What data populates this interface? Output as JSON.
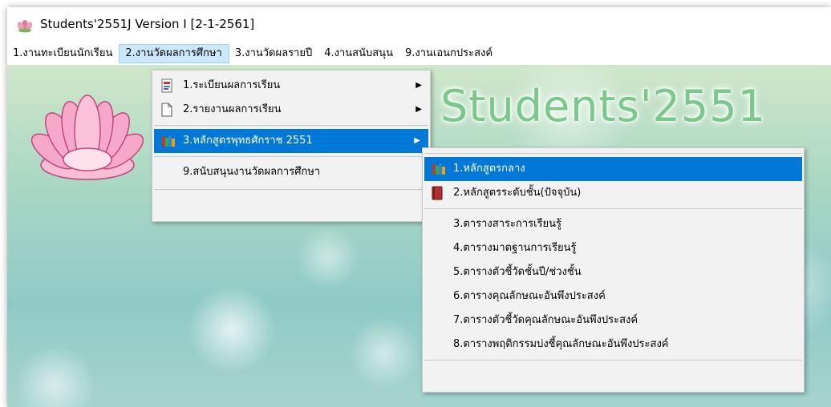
{
  "window": {
    "title": "Students'2551J Version I [2-1-2561]",
    "icon": "lotus-app-icon"
  },
  "menubar": {
    "items": [
      {
        "label": "1.งานทะเบียนนักเรียน"
      },
      {
        "label": "2.งานวัดผลการศึกษา",
        "active": true
      },
      {
        "label": "3.งานวัดผลรายปี"
      },
      {
        "label": "4.งานสนับสนุน"
      },
      {
        "label": "9.งานเอนกประสงค์"
      }
    ]
  },
  "background": {
    "brand_text": "Students'2551",
    "brand_color": "#7bc88c"
  },
  "menu": {
    "items": [
      {
        "label": "1.ระเบียนผลการเรียน",
        "icon": "document-book-icon",
        "has_submenu": true
      },
      {
        "label": "2.รายงานผลการเรียน",
        "icon": "blank-page-icon",
        "has_submenu": true
      },
      {
        "label": "3.หลักสูตรพุทธศักราช 2551",
        "icon": "books-stack-icon",
        "has_submenu": true,
        "highlighted": true
      },
      {
        "label": "9.สนับสนุนงานวัดผลการศึกษา",
        "icon": "",
        "has_submenu": false
      }
    ]
  },
  "submenu": {
    "items": [
      {
        "label": "1.หลักสูตรกลาง",
        "icon": "books-stack-icon",
        "highlighted": true
      },
      {
        "label": "2.หลักสูตรระดับชั้น(ปัจจุบัน)",
        "icon": "red-book-icon"
      },
      {
        "label": "3.ตารางสาระการเรียนรู้"
      },
      {
        "label": "4.ตารางมาตฐานการเรียนรู้"
      },
      {
        "label": "5.ตารางตัวชี้วัดชั้นปี/ช่วงชั้น"
      },
      {
        "label": "6.ตารางคุณลักษณะอันพึงประสงค์"
      },
      {
        "label": "7.ตารางตัวชี้วัดคุณลักษณะอันพึงประสงค์"
      },
      {
        "label": "8.ตารางพฤติกรรมบ่งชี้คุณลักษณะอันพึงประสงค์"
      }
    ]
  },
  "colors": {
    "highlight": "#0078d7",
    "menubar_active": "#cce8ff"
  }
}
